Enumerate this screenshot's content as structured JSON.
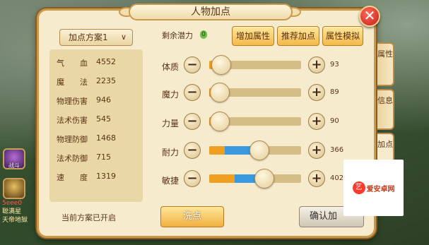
{
  "window": {
    "title": "人物加点"
  },
  "scheme": {
    "label": "加点方案1"
  },
  "stats": [
    {
      "name": "气　　血",
      "value": "4552"
    },
    {
      "name": "魔　　法",
      "value": "2235"
    },
    {
      "name": "物理伤害",
      "value": "946"
    },
    {
      "name": "法术伤害",
      "value": "545"
    },
    {
      "name": "物理防御",
      "value": "1468"
    },
    {
      "name": "法术防御",
      "value": "715"
    },
    {
      "name": "速　　度",
      "value": "1319"
    }
  ],
  "status": "当前方案已开启",
  "remaining": {
    "label": "剩余潜力",
    "value": "0"
  },
  "top_buttons": {
    "add": "增加属性",
    "recommend": "推荐加点",
    "simulate": "属性模拟"
  },
  "attributes": [
    {
      "name": "体质",
      "value": "93",
      "level": 0.0
    },
    {
      "name": "魔力",
      "value": "89",
      "level": 0.0
    },
    {
      "name": "力量",
      "value": "90",
      "level": 0.0
    },
    {
      "name": "耐力",
      "value": "366",
      "level": 0.55
    },
    {
      "name": "敏捷",
      "value": "402",
      "level": 0.6
    }
  ],
  "buttons": {
    "wash": "洗点",
    "confirm": "确认加"
  },
  "side_tabs": {
    "attr": "属性",
    "info": "信息",
    "points": "加点"
  },
  "side_icons": {
    "a": "战斗",
    "b": ""
  },
  "chat": {
    "line1": "5eee0",
    "line2": "聪满星",
    "line3": "天帝地獄"
  },
  "watermark": {
    "text": "爱安卓网",
    "logo": "艺"
  },
  "colors": {
    "panel": "#f7ebcd",
    "border": "#c99a4c",
    "button": "#f3b94a",
    "close": "#c21f16"
  }
}
